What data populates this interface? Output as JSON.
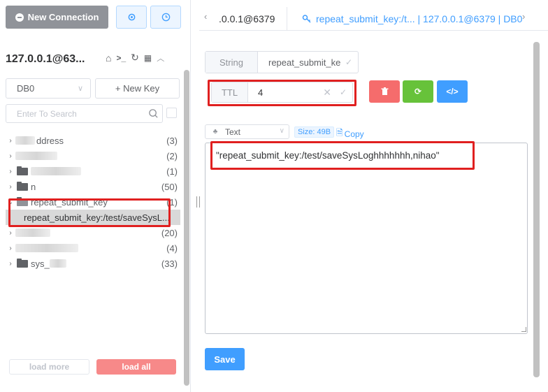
{
  "toolbar": {
    "new_connection_label": "New Connection"
  },
  "connection": {
    "title": "127.0.0.1@63..."
  },
  "db_select": {
    "selected": "DB0"
  },
  "new_key_label": "+ New Key",
  "search": {
    "placeholder": "Enter To Search"
  },
  "tree": {
    "nodes": [
      {
        "name": "ddress",
        "count": "(3)"
      },
      {
        "name": "",
        "count": "(2)"
      },
      {
        "name": "",
        "count": "(1)"
      },
      {
        "name": "n",
        "count": "(50)"
      },
      {
        "name": "repeat_submit_key",
        "count": "(1)"
      },
      {
        "name": "repeat_submit_key:/test/saveSysL...",
        "count": ""
      },
      {
        "name": "",
        "count": "(20)"
      },
      {
        "name": "",
        "count": "(4)"
      },
      {
        "name": "sys_",
        "count": "(33)"
      }
    ]
  },
  "pager": {
    "load_more": "load more",
    "load_all": "load all"
  },
  "tabs": {
    "tab1": ".0.0.1@6379",
    "tab2": "repeat_submit_key:/t... | 127.0.0.1@6379 | DB0"
  },
  "key": {
    "type_label": "String",
    "name_value": "repeat_submit_ke",
    "ttl_label": "TTL",
    "ttl_value": "4"
  },
  "viewer": {
    "format": "Text",
    "size": "Size: 49B",
    "copy": "Copy",
    "value": "\"repeat_submit_key:/test/saveSysLoghhhhhhh,nihao\""
  },
  "save_label": "Save",
  "colors": {
    "primary": "#409eff",
    "danger": "#f56c6c",
    "success": "#67c23a",
    "highlight": "#e02020"
  }
}
